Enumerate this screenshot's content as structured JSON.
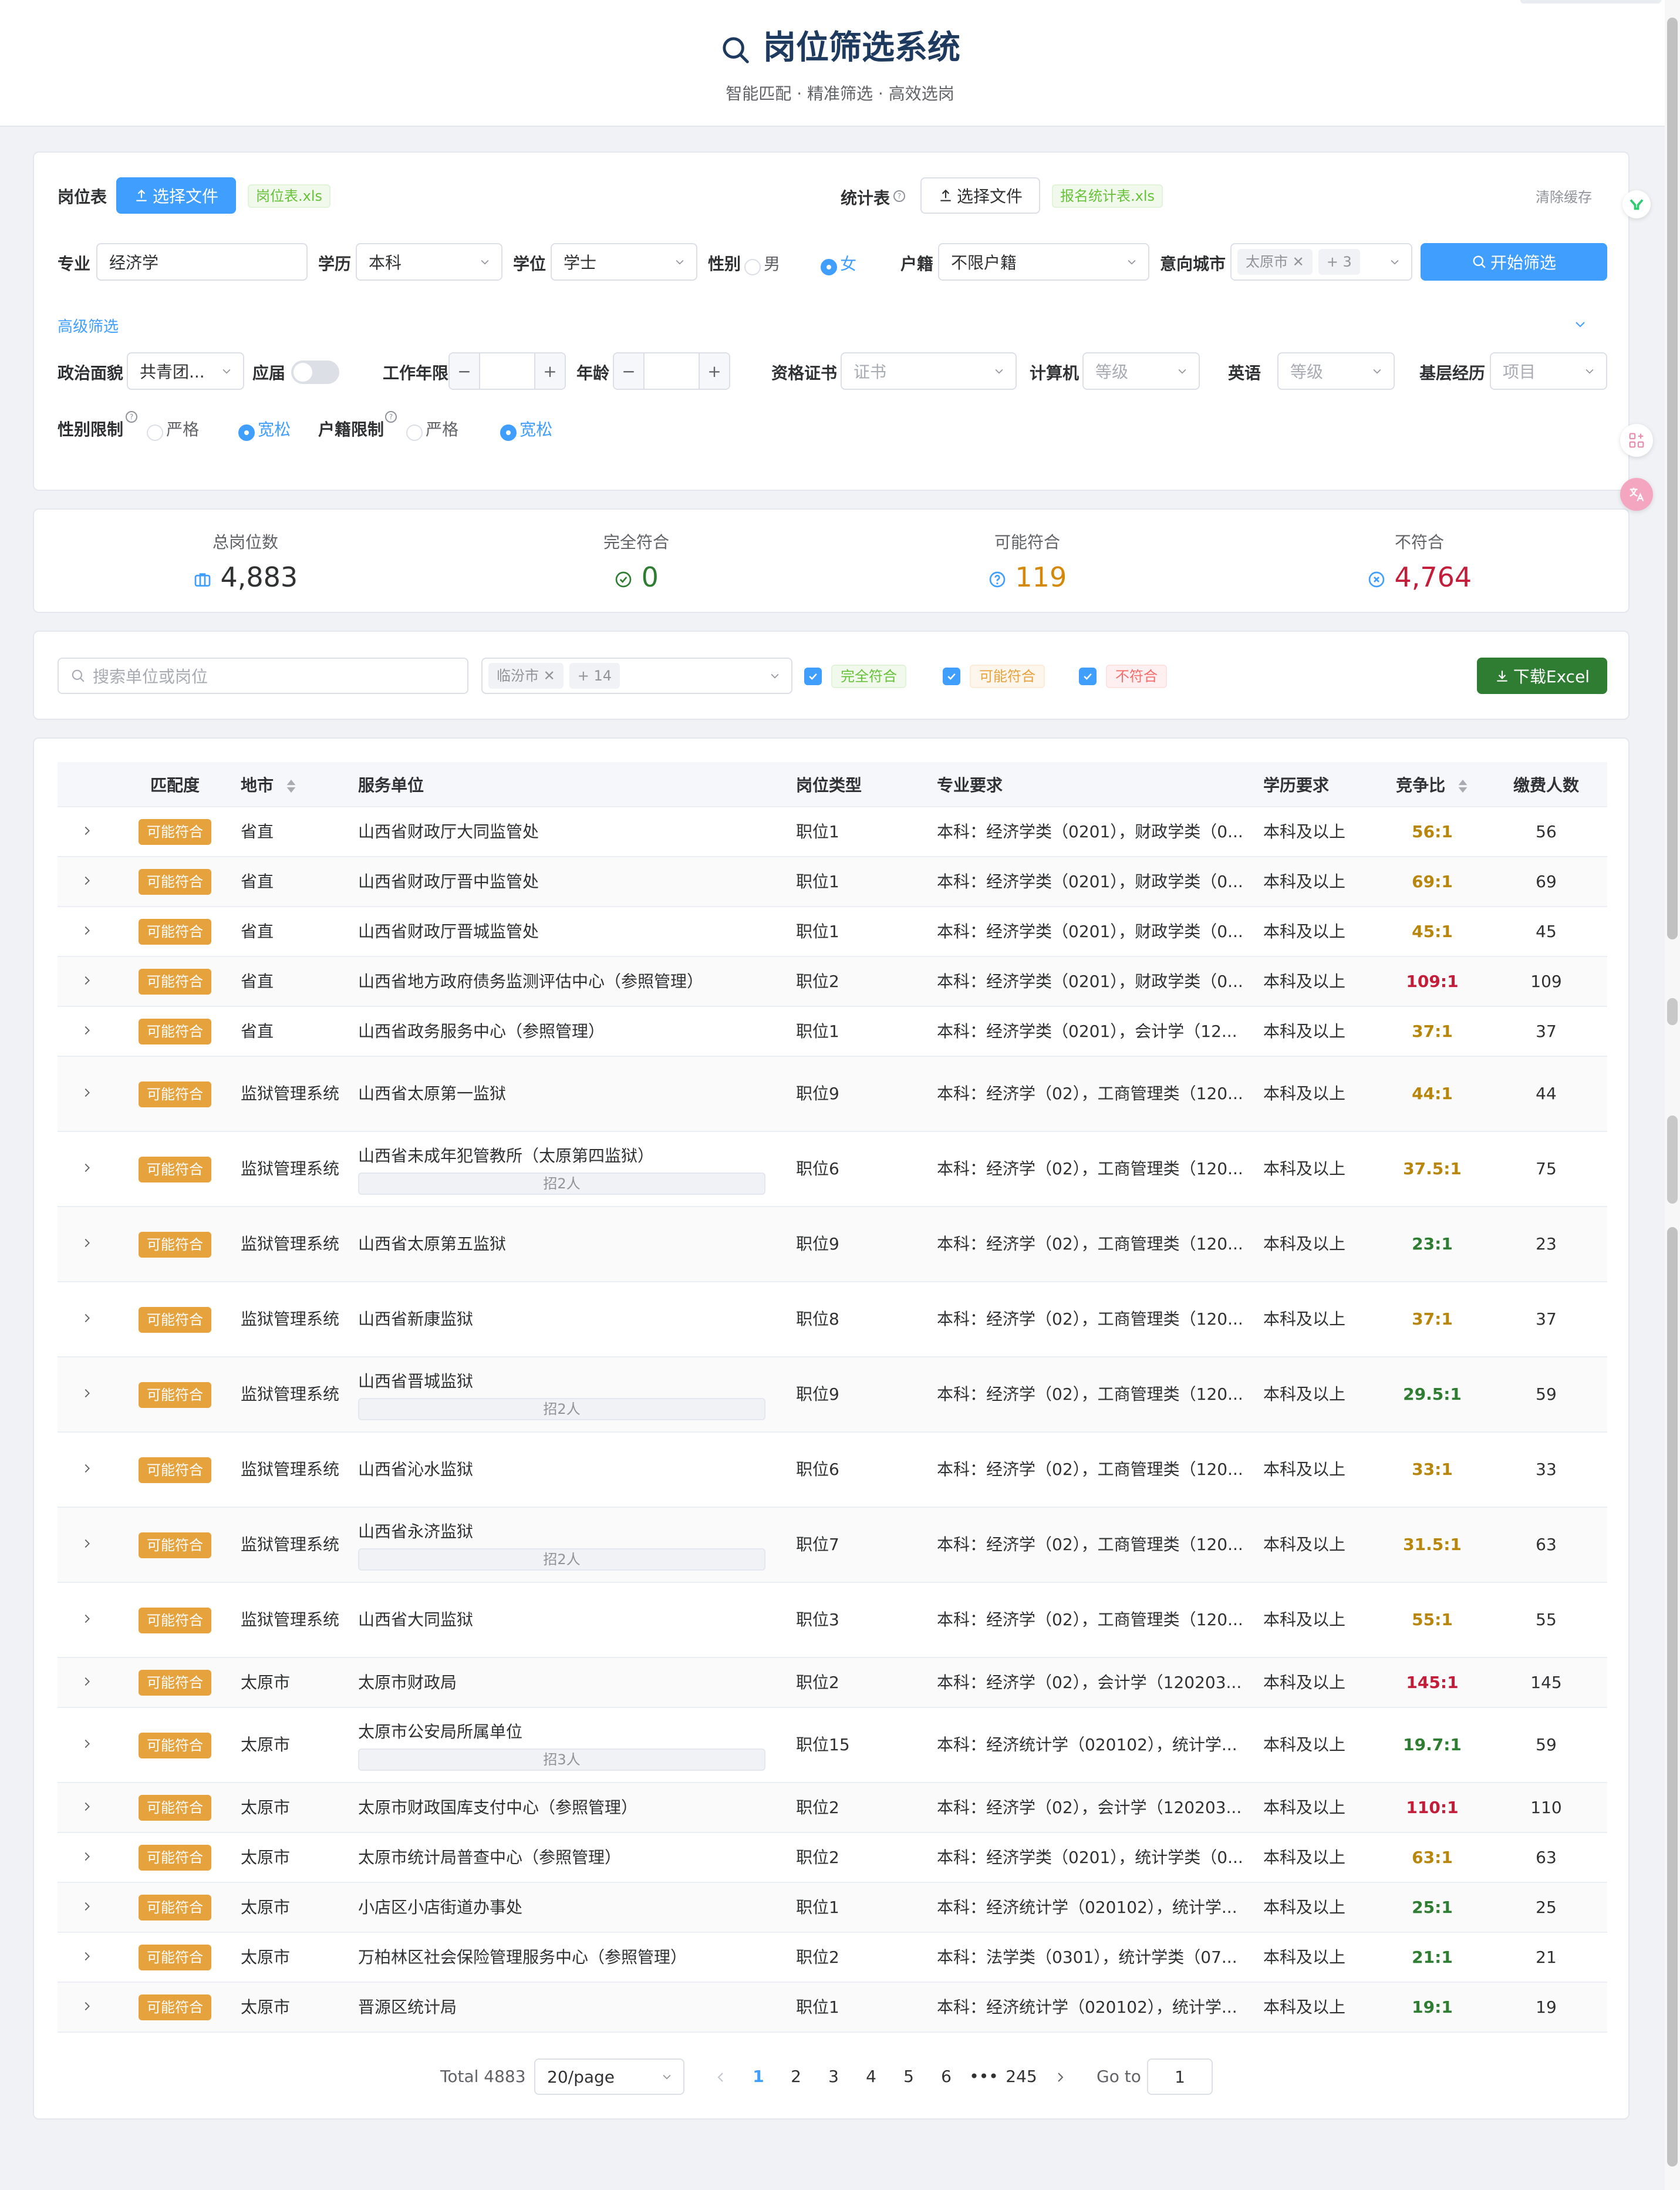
{
  "header": {
    "title": "岗位筛选系统",
    "subtitle": "智能匹配 · 精准筛选 · 高效选岗"
  },
  "upload": {
    "post_label": "岗位表",
    "post_btn": "选择文件",
    "post_file": "岗位表.xls",
    "stat_label": "统计表",
    "stat_btn": "选择文件",
    "stat_file": "报名统计表.xls",
    "clear_cache": "清除缓存"
  },
  "filters": {
    "major_label": "专业",
    "major_value": "经济学",
    "edu_label": "学历",
    "edu_value": "本科",
    "degree_label": "学位",
    "degree_value": "学士",
    "gender_label": "性别",
    "gender_male": "男",
    "gender_female": "女",
    "huji_label": "户籍",
    "huji_value": "不限户籍",
    "city_label": "意向城市",
    "city_chip": "太原市",
    "city_more": "+ 3",
    "start_btn": "开始筛选"
  },
  "advanced": {
    "toggle_label": "高级筛选",
    "political_label": "政治面貌",
    "political_value": "共青团...",
    "fresh_label": "应届",
    "work_years_label": "工作年限",
    "age_label": "年龄",
    "cert_label": "资格证书",
    "cert_placeholder": "证书",
    "computer_label": "计算机",
    "computer_placeholder": "等级",
    "english_label": "英语",
    "english_placeholder": "等级",
    "grassroots_label": "基层经历",
    "grassroots_placeholder": "项目",
    "gender_limit_label": "性别限制",
    "huji_limit_label": "户籍限制",
    "strict": "严格",
    "loose": "宽松"
  },
  "stats": [
    {
      "label": "总岗位数",
      "value": "4,883",
      "icon": "briefcase-icon",
      "color": "#303133"
    },
    {
      "label": "完全符合",
      "value": "0",
      "icon": "check-circle-icon",
      "color": "#2e7d32"
    },
    {
      "label": "可能符合",
      "value": "119",
      "icon": "question-circle-icon",
      "color": "#d48806"
    },
    {
      "label": "不符合",
      "value": "4,764",
      "icon": "x-circle-icon",
      "color": "#c41d3a"
    }
  ],
  "toolbar": {
    "search_placeholder": "搜索单位或岗位",
    "city_chip": "临汾市",
    "city_more": "+ 14",
    "full": "完全符合",
    "maybe": "可能符合",
    "none": "不符合",
    "download": "下载Excel"
  },
  "colors": {
    "primary": "#409eff",
    "warning": "#e6a23c",
    "success_dark": "#2e7d32",
    "danger": "#c41d3a"
  },
  "table": {
    "headers": [
      "匹配度",
      "地市",
      "服务单位",
      "岗位类型",
      "专业要求",
      "学历要求",
      "竞争比",
      "缴费人数"
    ],
    "rows": [
      {
        "match": "可能符合",
        "city": "省直",
        "unit": "山西省财政厅大同监管处",
        "recruit": "",
        "type": "职位1",
        "major": "本科：经济学类（0201），财政学类（0...",
        "edu": "本科及以上",
        "ratio": "56:1",
        "ratio_color": "#b8860b",
        "paid": "56"
      },
      {
        "match": "可能符合",
        "city": "省直",
        "unit": "山西省财政厅晋中监管处",
        "recruit": "",
        "type": "职位1",
        "major": "本科：经济学类（0201），财政学类（0...",
        "edu": "本科及以上",
        "ratio": "69:1",
        "ratio_color": "#b8860b",
        "paid": "69"
      },
      {
        "match": "可能符合",
        "city": "省直",
        "unit": "山西省财政厅晋城监管处",
        "recruit": "",
        "type": "职位1",
        "major": "本科：经济学类（0201），财政学类（0...",
        "edu": "本科及以上",
        "ratio": "45:1",
        "ratio_color": "#b8860b",
        "paid": "45"
      },
      {
        "match": "可能符合",
        "city": "省直",
        "unit": "山西省地方政府债务监测评估中心（参照管理）",
        "recruit": "",
        "type": "职位2",
        "major": "本科：经济学类（0201），财政学类（0...",
        "edu": "本科及以上",
        "ratio": "109:1",
        "ratio_color": "#c41d3a",
        "paid": "109"
      },
      {
        "match": "可能符合",
        "city": "省直",
        "unit": "山西省政务服务中心（参照管理）",
        "recruit": "",
        "type": "职位1",
        "major": "本科：经济学类（0201），会计学（12...",
        "edu": "本科及以上",
        "ratio": "37:1",
        "ratio_color": "#b8860b",
        "paid": "37"
      },
      {
        "match": "可能符合",
        "city": "监狱管理系统",
        "unit": "山西省太原第一监狱",
        "recruit": "",
        "type": "职位9",
        "major": "本科：经济学（02），工商管理类（120...",
        "edu": "本科及以上",
        "ratio": "44:1",
        "ratio_color": "#b8860b",
        "paid": "44"
      },
      {
        "match": "可能符合",
        "city": "监狱管理系统",
        "unit": "山西省未成年犯管教所（太原第四监狱）",
        "recruit": "招2人",
        "type": "职位6",
        "major": "本科：经济学（02），工商管理类（120...",
        "edu": "本科及以上",
        "ratio": "37.5:1",
        "ratio_color": "#b8860b",
        "paid": "75"
      },
      {
        "match": "可能符合",
        "city": "监狱管理系统",
        "unit": "山西省太原第五监狱",
        "recruit": "",
        "type": "职位9",
        "major": "本科：经济学（02），工商管理类（120...",
        "edu": "本科及以上",
        "ratio": "23:1",
        "ratio_color": "#2e7d32",
        "paid": "23"
      },
      {
        "match": "可能符合",
        "city": "监狱管理系统",
        "unit": "山西省新康监狱",
        "recruit": "",
        "type": "职位8",
        "major": "本科：经济学（02），工商管理类（120...",
        "edu": "本科及以上",
        "ratio": "37:1",
        "ratio_color": "#b8860b",
        "paid": "37"
      },
      {
        "match": "可能符合",
        "city": "监狱管理系统",
        "unit": "山西省晋城监狱",
        "recruit": "招2人",
        "type": "职位9",
        "major": "本科：经济学（02），工商管理类（120...",
        "edu": "本科及以上",
        "ratio": "29.5:1",
        "ratio_color": "#2e7d32",
        "paid": "59"
      },
      {
        "match": "可能符合",
        "city": "监狱管理系统",
        "unit": "山西省沁水监狱",
        "recruit": "",
        "type": "职位6",
        "major": "本科：经济学（02），工商管理类（120...",
        "edu": "本科及以上",
        "ratio": "33:1",
        "ratio_color": "#b8860b",
        "paid": "33"
      },
      {
        "match": "可能符合",
        "city": "监狱管理系统",
        "unit": "山西省永济监狱",
        "recruit": "招2人",
        "type": "职位7",
        "major": "本科：经济学（02），工商管理类（120...",
        "edu": "本科及以上",
        "ratio": "31.5:1",
        "ratio_color": "#b8860b",
        "paid": "63"
      },
      {
        "match": "可能符合",
        "city": "监狱管理系统",
        "unit": "山西省大同监狱",
        "recruit": "",
        "type": "职位3",
        "major": "本科：经济学（02），工商管理类（120...",
        "edu": "本科及以上",
        "ratio": "55:1",
        "ratio_color": "#b8860b",
        "paid": "55"
      },
      {
        "match": "可能符合",
        "city": "太原市",
        "unit": "太原市财政局",
        "recruit": "",
        "type": "职位2",
        "major": "本科：经济学（02），会计学（120203...",
        "edu": "本科及以上",
        "ratio": "145:1",
        "ratio_color": "#c41d3a",
        "paid": "145"
      },
      {
        "match": "可能符合",
        "city": "太原市",
        "unit": "太原市公安局所属单位",
        "recruit": "招3人",
        "type": "职位15",
        "major": "本科：经济统计学（020102），统计学...",
        "edu": "本科及以上",
        "ratio": "19.7:1",
        "ratio_color": "#2e7d32",
        "paid": "59"
      },
      {
        "match": "可能符合",
        "city": "太原市",
        "unit": "太原市财政国库支付中心（参照管理）",
        "recruit": "",
        "type": "职位2",
        "major": "本科：经济学（02），会计学（120203...",
        "edu": "本科及以上",
        "ratio": "110:1",
        "ratio_color": "#c41d3a",
        "paid": "110"
      },
      {
        "match": "可能符合",
        "city": "太原市",
        "unit": "太原市统计局普查中心（参照管理）",
        "recruit": "",
        "type": "职位2",
        "major": "本科：经济学类（0201），统计学类（0...",
        "edu": "本科及以上",
        "ratio": "63:1",
        "ratio_color": "#b8860b",
        "paid": "63"
      },
      {
        "match": "可能符合",
        "city": "太原市",
        "unit": "小店区小店街道办事处",
        "recruit": "",
        "type": "职位1",
        "major": "本科：经济统计学（020102），统计学...",
        "edu": "本科及以上",
        "ratio": "25:1",
        "ratio_color": "#2e7d32",
        "paid": "25"
      },
      {
        "match": "可能符合",
        "city": "太原市",
        "unit": "万柏林区社会保险管理服务中心（参照管理）",
        "recruit": "",
        "type": "职位2",
        "major": "本科：法学类（0301），统计学类（07...",
        "edu": "本科及以上",
        "ratio": "21:1",
        "ratio_color": "#2e7d32",
        "paid": "21"
      },
      {
        "match": "可能符合",
        "city": "太原市",
        "unit": "晋源区统计局",
        "recruit": "",
        "type": "职位1",
        "major": "本科：经济统计学（020102），统计学...",
        "edu": "本科及以上",
        "ratio": "19:1",
        "ratio_color": "#2e7d32",
        "paid": "19"
      }
    ]
  },
  "pagination": {
    "total": "Total 4883",
    "page_size": "20/page",
    "pages": [
      "1",
      "2",
      "3",
      "4",
      "5",
      "6"
    ],
    "ellipsis": "•••",
    "last": "245",
    "goto_label": "Go to",
    "goto_value": "1"
  }
}
